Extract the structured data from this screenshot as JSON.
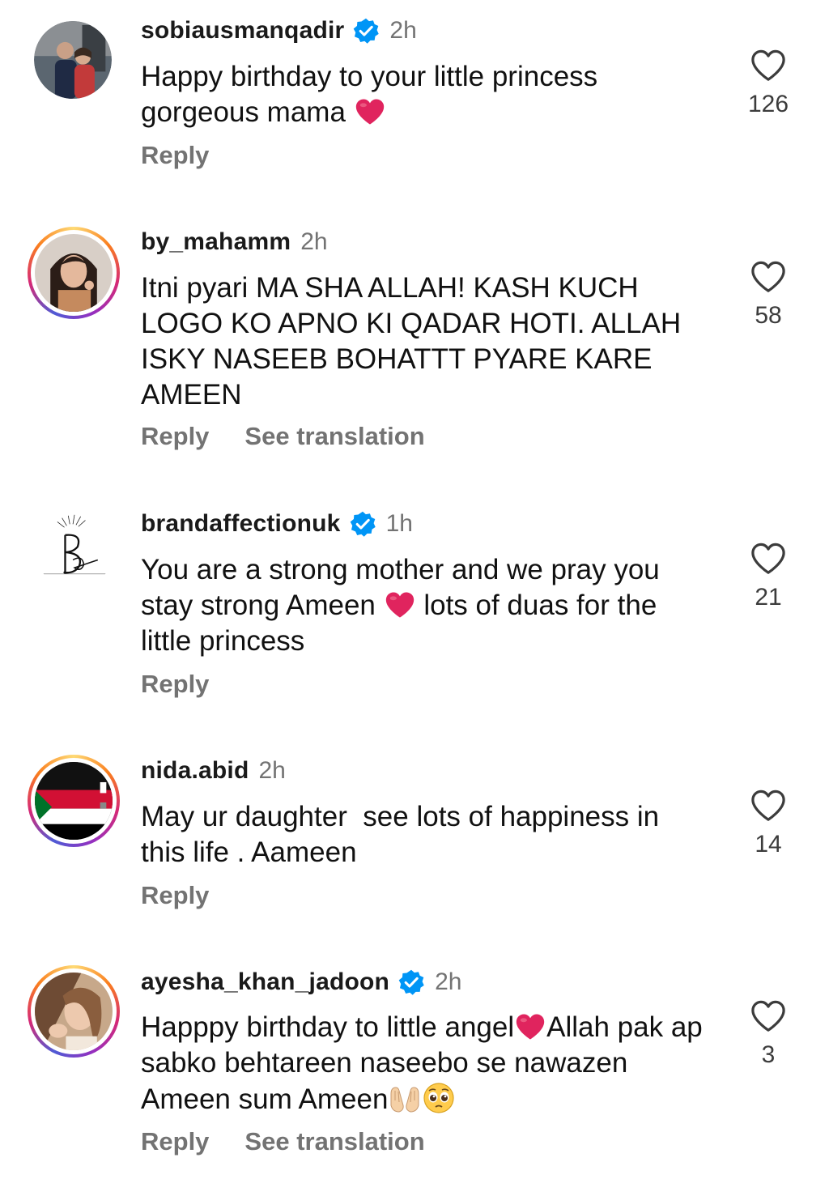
{
  "comments": [
    {
      "username": "sobiausmanqadir",
      "verified": true,
      "time": "2h",
      "text_before": "Happy birthday to your little princess gorgeous mama ",
      "likes": "126",
      "reply": "Reply"
    },
    {
      "username": "by_mahamm",
      "verified": false,
      "time": "2h",
      "text": "Itni pyari MA SHA ALLAH! KASH KUCH LOGO KO APNO KI QADAR HOTI. ALLAH ISKY NASEEB BOHATTT PYARE KARE AMEEN",
      "likes": "58",
      "reply": "Reply",
      "see_translation": "See translation"
    },
    {
      "username": "brandaffectionuk",
      "verified": true,
      "time": "1h",
      "text_before": "You are a strong mother and we pray you stay strong Ameen ",
      "text_after": " lots of duas for the little princess",
      "likes": "21",
      "reply": "Reply"
    },
    {
      "username": "nida.abid",
      "verified": false,
      "time": "2h",
      "text": "May ur daughter  see lots of happiness in this life . Aameen",
      "likes": "14",
      "reply": "Reply"
    },
    {
      "username": "ayesha_khan_jadoon",
      "verified": true,
      "time": "2h",
      "text_before": "Happpy birthday to little angel",
      "text_mid": "Allah pak ap sabko behtareen naseebo se nawazen Ameen sum Ameen",
      "likes": "3",
      "reply": "Reply",
      "see_translation": "See translation"
    }
  ],
  "colors": {
    "verified_blue": "#0095f6",
    "heart_red": "#e0245e",
    "secondary_text": "#737373"
  },
  "icons": {
    "like": "heart-outline-icon",
    "verified": "verified-badge-icon",
    "emoji_heart": "red-heart-emoji",
    "emoji_hands": "palms-up-together-emoji",
    "emoji_pleading": "pleading-face-emoji"
  }
}
